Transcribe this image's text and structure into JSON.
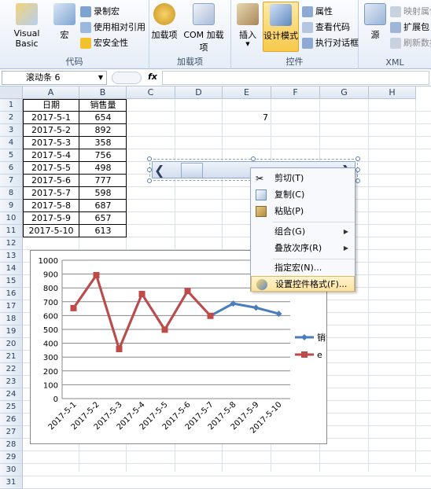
{
  "ribbon": {
    "groups": [
      {
        "label": "代码"
      },
      {
        "label": "加载项"
      },
      {
        "label": "控件"
      },
      {
        "label": "XML"
      }
    ],
    "visual_basic": "Visual Basic",
    "macros": "宏",
    "record_macro": "录制宏",
    "relative_ref": "使用相对引用",
    "macro_security": "宏安全性",
    "addins": "加载项",
    "com_addins": "COM 加载项",
    "insert": "插入",
    "design_mode": "设计模式",
    "properties": "属性",
    "view_code": "查看代码",
    "run_dialog": "执行对话框",
    "source": "源",
    "map_props": "映射属性",
    "expansion": "扩展包",
    "refresh": "刷新数据"
  },
  "formula_bar": {
    "name_box": "滚动条 6",
    "fx": "fx"
  },
  "columns": [
    "A",
    "B",
    "C",
    "D",
    "E",
    "F",
    "G",
    "H"
  ],
  "rows": [
    "1",
    "2",
    "3",
    "4",
    "5",
    "6",
    "7",
    "8",
    "9",
    "10",
    "11",
    "12",
    "13",
    "14",
    "15",
    "16",
    "17",
    "18",
    "19",
    "20",
    "21",
    "22",
    "23",
    "24",
    "25",
    "26",
    "27",
    "28",
    "29",
    "30",
    "31"
  ],
  "table": {
    "headers": [
      "日期",
      "销售量"
    ],
    "rows": [
      [
        "2017-5-1",
        "654"
      ],
      [
        "2017-5-2",
        "892"
      ],
      [
        "2017-5-3",
        "358"
      ],
      [
        "2017-5-4",
        "756"
      ],
      [
        "2017-5-5",
        "498"
      ],
      [
        "2017-5-6",
        "777"
      ],
      [
        "2017-5-7",
        "598"
      ],
      [
        "2017-5-8",
        "687"
      ],
      [
        "2017-5-9",
        "657"
      ],
      [
        "2017-5-10",
        "613"
      ]
    ]
  },
  "cell_e2": "7",
  "context_menu": {
    "items": [
      {
        "label": "剪切(T)"
      },
      {
        "label": "复制(C)"
      },
      {
        "label": "粘贴(P)"
      },
      {
        "label": "组合(G)"
      },
      {
        "label": "叠放次序(R)"
      },
      {
        "label": "指定宏(N)..."
      },
      {
        "label": "设置控件格式(F)..."
      }
    ]
  },
  "colors": {
    "blue_series": "#4a7ebb",
    "red_series": "#be4b48",
    "menu_highlight": "#fde3a0"
  },
  "chart_data": {
    "type": "line",
    "categories": [
      "2017-5-1",
      "2017-5-2",
      "2017-5-3",
      "2017-5-4",
      "2017-5-5",
      "2017-5-6",
      "2017-5-7",
      "2017-5-8",
      "2017-5-9",
      "2017-5-10"
    ],
    "series": [
      {
        "name": "销售量",
        "color": "#4a7ebb",
        "values": [
          654,
          892,
          358,
          756,
          498,
          777,
          598,
          687,
          657,
          613
        ]
      },
      {
        "name": "e",
        "color": "#be4b48",
        "values": [
          654,
          892,
          358,
          756,
          498,
          777,
          598,
          null,
          null,
          null
        ]
      }
    ],
    "ylim": [
      0,
      1000
    ],
    "yticks": [
      "0",
      "100",
      "200",
      "300",
      "400",
      "500",
      "600",
      "700",
      "800",
      "900",
      "1000"
    ],
    "grid": true,
    "legend": "right"
  }
}
